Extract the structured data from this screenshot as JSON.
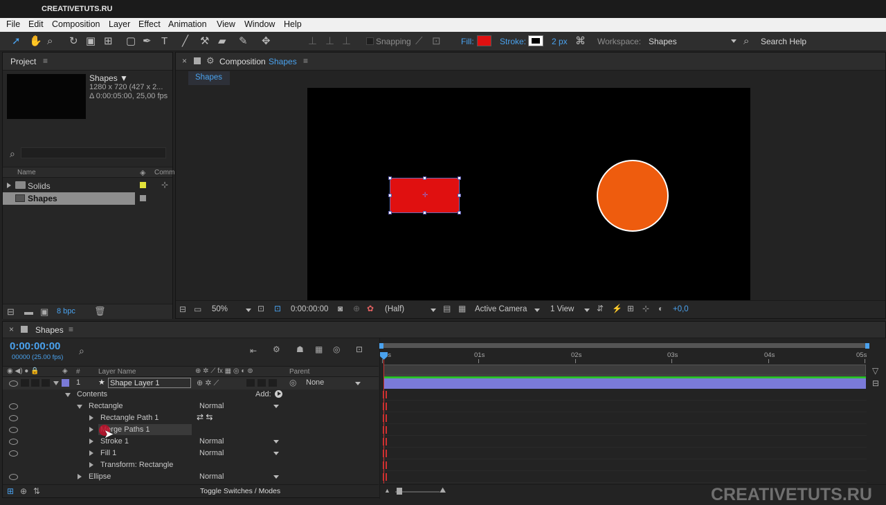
{
  "window": {
    "title": "CREATIVETUTS.RU"
  },
  "menu": [
    "File",
    "Edit",
    "Composition",
    "Layer",
    "Effect",
    "Animation",
    "View",
    "Window",
    "Help"
  ],
  "toolbar": {
    "snapping": "Snapping",
    "fill_label": "Fill:",
    "fill_color": "#e01010",
    "stroke_label": "Stroke:",
    "stroke_width": "2 px",
    "workspace_label": "Workspace:",
    "workspace_value": "Shapes",
    "search_help": "Search Help"
  },
  "project": {
    "tab": "Project",
    "comp_name": "Shapes ▼",
    "comp_size": "1280 x 720  (427 x 2...",
    "comp_duration": "Δ 0:00:05:00, 25,00 fps",
    "col_name": "Name",
    "col_comment": "Comm",
    "items": [
      {
        "name": "Solids",
        "label_color": "#e2e23a"
      },
      {
        "name": "Shapes",
        "label_color": "#c8c8c8"
      }
    ],
    "bpc": "8 bpc"
  },
  "composition": {
    "tab_prefix": "Composition",
    "tab_name": "Shapes",
    "subtab": "Shapes",
    "rect_color": "#e01010",
    "circle_color": "#ee5c0e",
    "zoom": "50%",
    "timecode": "0:00:00:00",
    "resolution": "(Half)",
    "camera": "Active Camera",
    "view": "1 View",
    "exposure": "+0,0"
  },
  "timeline": {
    "tab": "Shapes",
    "timecode": "0:00:00:00",
    "frames": "00000 (25.00 fps)",
    "col_num": "#",
    "col_layer": "Layer Name",
    "col_parent": "Parent",
    "ruler": [
      "0s",
      "01s",
      "02s",
      "03s",
      "04s",
      "05s"
    ],
    "layer": {
      "num": "1",
      "name": "Shape Layer 1",
      "parent": "None",
      "color": "#7a7ad8"
    },
    "contents": "Contents",
    "add": "Add:",
    "rows": [
      {
        "label": "Rectangle",
        "mode": "Normal"
      },
      {
        "label": "Rectangle Path 1",
        "mode": ""
      },
      {
        "label": "Merge Paths 1",
        "mode": ""
      },
      {
        "label": "Stroke 1",
        "mode": "Normal"
      },
      {
        "label": "Fill 1",
        "mode": "Normal"
      },
      {
        "label": "Transform: Rectangle",
        "mode": ""
      },
      {
        "label": "Ellipse",
        "mode": "Normal"
      }
    ],
    "toggle": "Toggle Switches / Modes",
    "watermark": "CREATIVETUTS.RU"
  }
}
